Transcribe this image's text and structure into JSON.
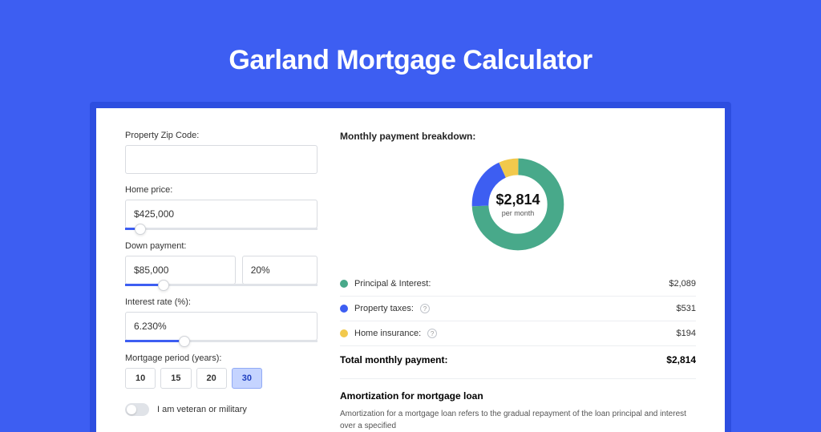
{
  "page": {
    "title": "Garland Mortgage Calculator"
  },
  "form": {
    "zip_label": "Property Zip Code:",
    "zip_value": "",
    "home_price_label": "Home price:",
    "home_price_value": "$425,000",
    "home_price_slider_pct": 8,
    "down_payment_label": "Down payment:",
    "down_payment_value": "$85,000",
    "down_payment_pct_value": "20%",
    "down_payment_slider_pct": 20,
    "interest_label": "Interest rate (%):",
    "interest_value": "6.230%",
    "interest_slider_pct": 31,
    "period_label": "Mortgage period (years):",
    "periods": [
      "10",
      "15",
      "20",
      "30"
    ],
    "period_active": 3,
    "veteran_label": "I am veteran or military"
  },
  "breakdown": {
    "title": "Monthly payment breakdown:",
    "center_amount": "$2,814",
    "center_sub": "per month",
    "items": [
      {
        "label": "Principal & Interest:",
        "value": "$2,089",
        "color": "#48a98a",
        "info": false
      },
      {
        "label": "Property taxes:",
        "value": "$531",
        "color": "#3d5ef2",
        "info": true
      },
      {
        "label": "Home insurance:",
        "value": "$194",
        "color": "#f2c94c",
        "info": true
      }
    ],
    "total_label": "Total monthly payment:",
    "total_value": "$2,814"
  },
  "amortization": {
    "title": "Amortization for mortgage loan",
    "text": "Amortization for a mortgage loan refers to the gradual repayment of the loan principal and interest over a specified"
  },
  "chart_data": {
    "type": "pie",
    "title": "Monthly payment breakdown",
    "series": [
      {
        "name": "Principal & Interest",
        "value": 2089,
        "color": "#48a98a"
      },
      {
        "name": "Property taxes",
        "value": 531,
        "color": "#3d5ef2"
      },
      {
        "name": "Home insurance",
        "value": 194,
        "color": "#f2c94c"
      }
    ],
    "total": 2814,
    "unit": "USD per month"
  }
}
